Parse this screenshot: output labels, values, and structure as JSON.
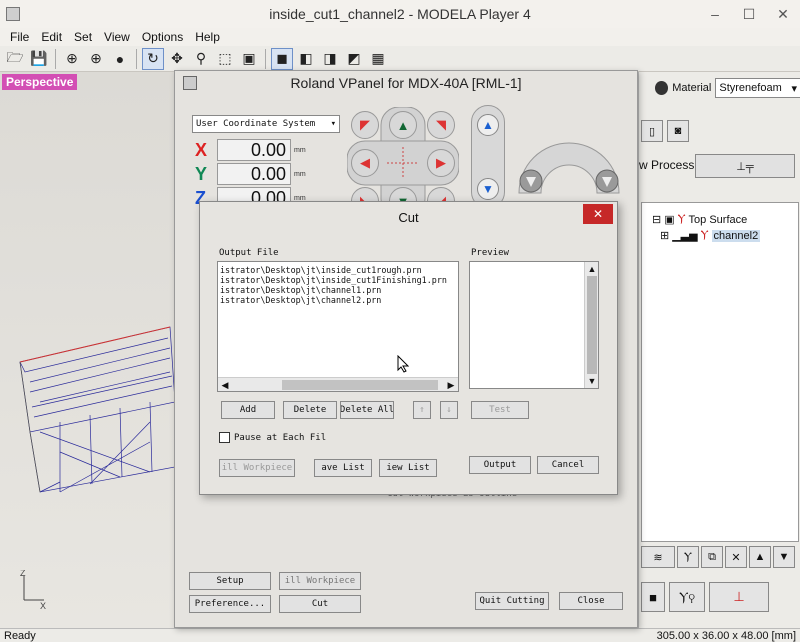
{
  "window": {
    "title": "inside_cut1_channel2 - MODELA Player 4",
    "min": "–",
    "max": "☐",
    "close": "✕"
  },
  "menu": [
    "File",
    "Edit",
    "Set",
    "View",
    "Options",
    "Help"
  ],
  "viewport": {
    "label": "Perspective",
    "axis": "Z\nX"
  },
  "right_panel": {
    "material_label": "Material",
    "material_value": "Styrenefoam",
    "new_process": "w Process",
    "tree": {
      "top_surface": "Top Surface",
      "channel2": "channel2"
    }
  },
  "status": {
    "left": "Ready",
    "right": "305.00 x 36.00 x 48.00 [mm]"
  },
  "vpanel": {
    "title": "Roland VPanel for MDX-40A [RML-1]",
    "coord_system": "User Coordinate System",
    "x_label": "X",
    "x_value": "0.00",
    "y_label": "Y",
    "y_value": "0.00",
    "z_label": "Z",
    "z_value": "0.00",
    "unit": "mm",
    "buttons": {
      "setup": "Setup",
      "fill_workpiece": "ill Workpiece",
      "preference": "Preference...",
      "cut": "Cut",
      "quit_cutting": "Quit Cutting",
      "close": "Close"
    },
    "cut_peek": "Cut workpiece as Outline"
  },
  "cut_dialog": {
    "title": "Cut",
    "output_file_label": "Output File",
    "preview_label": "Preview",
    "files": [
      "istrator\\Desktop\\jt\\inside_cut1rough.prn",
      "istrator\\Desktop\\jt\\inside_cut1Finishing1.prn",
      "istrator\\Desktop\\jt\\channel1.prn",
      "istrator\\Desktop\\jt\\channel2.prn"
    ],
    "add": "Add",
    "delete": "Delete",
    "delete_all": "Delete All",
    "test": "Test",
    "pause_label": "Pause at Each Fil",
    "fill_workpiece": "ill Workpiece",
    "save_list": "ave List",
    "view_list": "iew List",
    "output": "Output",
    "cancel": "Cancel"
  }
}
